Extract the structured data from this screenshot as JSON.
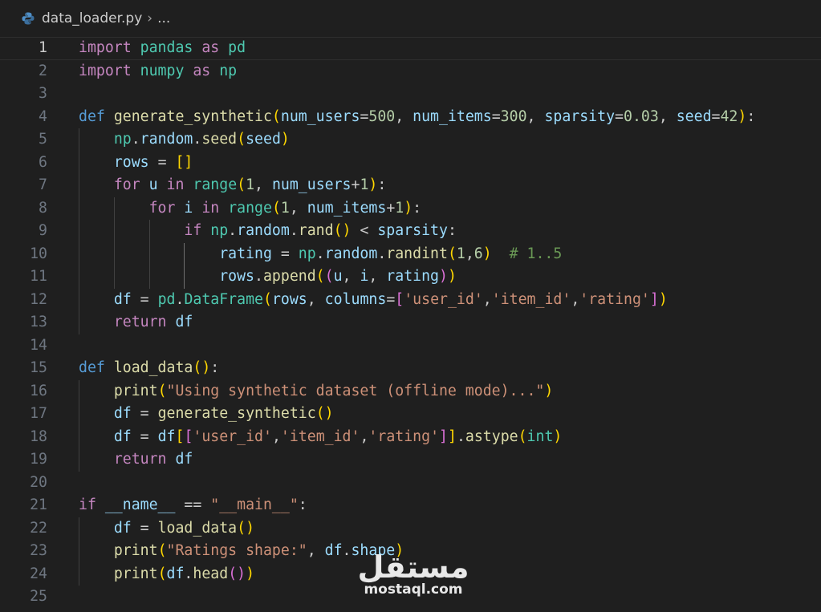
{
  "breadcrumb": {
    "file": "data_loader.py",
    "separator": "›",
    "more": "..."
  },
  "colors": {
    "keyword": "#569cd6",
    "control": "#c586c0",
    "function": "#dcdcaa",
    "variable": "#9cdcfe",
    "string": "#ce9178",
    "number": "#b5cea8",
    "type": "#4ec9b0",
    "comment": "#6a9955",
    "plain": "#cccccc",
    "bracket1": "#ffd700",
    "bracket2": "#da70d6",
    "bracket3": "#179fff"
  },
  "lines": [
    {
      "n": "1",
      "t": [
        [
          "c",
          "import"
        ],
        [
          "p",
          " "
        ],
        [
          "ty",
          "pandas"
        ],
        [
          "p",
          " "
        ],
        [
          "c",
          "as"
        ],
        [
          "p",
          " "
        ],
        [
          "ty",
          "pd"
        ]
      ]
    },
    {
      "n": "2",
      "t": [
        [
          "c",
          "import"
        ],
        [
          "p",
          " "
        ],
        [
          "ty",
          "numpy"
        ],
        [
          "p",
          " "
        ],
        [
          "c",
          "as"
        ],
        [
          "p",
          " "
        ],
        [
          "ty",
          "np"
        ]
      ]
    },
    {
      "n": "3",
      "t": []
    },
    {
      "n": "4",
      "t": [
        [
          "k",
          "def"
        ],
        [
          "p",
          " "
        ],
        [
          "f",
          "generate_synthetic"
        ],
        [
          "b1",
          "("
        ],
        [
          "v",
          "num_users"
        ],
        [
          "p",
          "="
        ],
        [
          "num",
          "500"
        ],
        [
          "p",
          ", "
        ],
        [
          "v",
          "num_items"
        ],
        [
          "p",
          "="
        ],
        [
          "num",
          "300"
        ],
        [
          "p",
          ", "
        ],
        [
          "v",
          "sparsity"
        ],
        [
          "p",
          "="
        ],
        [
          "num",
          "0.03"
        ],
        [
          "p",
          ", "
        ],
        [
          "v",
          "seed"
        ],
        [
          "p",
          "="
        ],
        [
          "num",
          "42"
        ],
        [
          "b1",
          ")"
        ],
        [
          "p",
          ":"
        ]
      ]
    },
    {
      "n": "5",
      "t": [
        [
          "p",
          "    "
        ],
        [
          "ty",
          "np"
        ],
        [
          "p",
          "."
        ],
        [
          "v",
          "random"
        ],
        [
          "p",
          "."
        ],
        [
          "f",
          "seed"
        ],
        [
          "b1",
          "("
        ],
        [
          "v",
          "seed"
        ],
        [
          "b1",
          ")"
        ]
      ]
    },
    {
      "n": "6",
      "t": [
        [
          "p",
          "    "
        ],
        [
          "v",
          "rows"
        ],
        [
          "p",
          " = "
        ],
        [
          "b1",
          "[]"
        ]
      ]
    },
    {
      "n": "7",
      "t": [
        [
          "p",
          "    "
        ],
        [
          "c",
          "for"
        ],
        [
          "p",
          " "
        ],
        [
          "v",
          "u"
        ],
        [
          "p",
          " "
        ],
        [
          "c",
          "in"
        ],
        [
          "p",
          " "
        ],
        [
          "ty",
          "range"
        ],
        [
          "b1",
          "("
        ],
        [
          "num",
          "1"
        ],
        [
          "p",
          ", "
        ],
        [
          "v",
          "num_users"
        ],
        [
          "p",
          "+"
        ],
        [
          "num",
          "1"
        ],
        [
          "b1",
          ")"
        ],
        [
          "p",
          ":"
        ]
      ]
    },
    {
      "n": "8",
      "t": [
        [
          "p",
          "        "
        ],
        [
          "c",
          "for"
        ],
        [
          "p",
          " "
        ],
        [
          "v",
          "i"
        ],
        [
          "p",
          " "
        ],
        [
          "c",
          "in"
        ],
        [
          "p",
          " "
        ],
        [
          "ty",
          "range"
        ],
        [
          "b1",
          "("
        ],
        [
          "num",
          "1"
        ],
        [
          "p",
          ", "
        ],
        [
          "v",
          "num_items"
        ],
        [
          "p",
          "+"
        ],
        [
          "num",
          "1"
        ],
        [
          "b1",
          ")"
        ],
        [
          "p",
          ":"
        ]
      ]
    },
    {
      "n": "9",
      "t": [
        [
          "p",
          "            "
        ],
        [
          "c",
          "if"
        ],
        [
          "p",
          " "
        ],
        [
          "ty",
          "np"
        ],
        [
          "p",
          "."
        ],
        [
          "v",
          "random"
        ],
        [
          "p",
          "."
        ],
        [
          "f",
          "rand"
        ],
        [
          "b1",
          "()"
        ],
        [
          "p",
          " < "
        ],
        [
          "v",
          "sparsity"
        ],
        [
          "p",
          ":"
        ]
      ]
    },
    {
      "n": "10",
      "t": [
        [
          "p",
          "                "
        ],
        [
          "v",
          "rating"
        ],
        [
          "p",
          " = "
        ],
        [
          "ty",
          "np"
        ],
        [
          "p",
          "."
        ],
        [
          "v",
          "random"
        ],
        [
          "p",
          "."
        ],
        [
          "f",
          "randint"
        ],
        [
          "b1",
          "("
        ],
        [
          "num",
          "1"
        ],
        [
          "p",
          ","
        ],
        [
          "num",
          "6"
        ],
        [
          "b1",
          ")"
        ],
        [
          "p",
          "  "
        ],
        [
          "cm",
          "# 1..5"
        ]
      ]
    },
    {
      "n": "11",
      "t": [
        [
          "p",
          "                "
        ],
        [
          "v",
          "rows"
        ],
        [
          "p",
          "."
        ],
        [
          "f",
          "append"
        ],
        [
          "b1",
          "("
        ],
        [
          "b2",
          "("
        ],
        [
          "v",
          "u"
        ],
        [
          "p",
          ", "
        ],
        [
          "v",
          "i"
        ],
        [
          "p",
          ", "
        ],
        [
          "v",
          "rating"
        ],
        [
          "b2",
          ")"
        ],
        [
          "b1",
          ")"
        ]
      ]
    },
    {
      "n": "12",
      "t": [
        [
          "p",
          "    "
        ],
        [
          "v",
          "df"
        ],
        [
          "p",
          " = "
        ],
        [
          "ty",
          "pd"
        ],
        [
          "p",
          "."
        ],
        [
          "ty",
          "DataFrame"
        ],
        [
          "b1",
          "("
        ],
        [
          "v",
          "rows"
        ],
        [
          "p",
          ", "
        ],
        [
          "v",
          "columns"
        ],
        [
          "p",
          "="
        ],
        [
          "b2",
          "["
        ],
        [
          "s",
          "'user_id'"
        ],
        [
          "p",
          ","
        ],
        [
          "s",
          "'item_id'"
        ],
        [
          "p",
          ","
        ],
        [
          "s",
          "'rating'"
        ],
        [
          "b2",
          "]"
        ],
        [
          "b1",
          ")"
        ]
      ]
    },
    {
      "n": "13",
      "t": [
        [
          "p",
          "    "
        ],
        [
          "c",
          "return"
        ],
        [
          "p",
          " "
        ],
        [
          "v",
          "df"
        ]
      ]
    },
    {
      "n": "14",
      "t": []
    },
    {
      "n": "15",
      "t": [
        [
          "k",
          "def"
        ],
        [
          "p",
          " "
        ],
        [
          "f",
          "load_data"
        ],
        [
          "b1",
          "()"
        ],
        [
          "p",
          ":"
        ]
      ]
    },
    {
      "n": "16",
      "t": [
        [
          "p",
          "    "
        ],
        [
          "f",
          "print"
        ],
        [
          "b1",
          "("
        ],
        [
          "s",
          "\"Using synthetic dataset (offline mode)...\""
        ],
        [
          "b1",
          ")"
        ]
      ]
    },
    {
      "n": "17",
      "t": [
        [
          "p",
          "    "
        ],
        [
          "v",
          "df"
        ],
        [
          "p",
          " = "
        ],
        [
          "f",
          "generate_synthetic"
        ],
        [
          "b1",
          "()"
        ]
      ]
    },
    {
      "n": "18",
      "t": [
        [
          "p",
          "    "
        ],
        [
          "v",
          "df"
        ],
        [
          "p",
          " = "
        ],
        [
          "v",
          "df"
        ],
        [
          "b1",
          "["
        ],
        [
          "b2",
          "["
        ],
        [
          "s",
          "'user_id'"
        ],
        [
          "p",
          ","
        ],
        [
          "s",
          "'item_id'"
        ],
        [
          "p",
          ","
        ],
        [
          "s",
          "'rating'"
        ],
        [
          "b2",
          "]"
        ],
        [
          "b1",
          "]"
        ],
        [
          "p",
          "."
        ],
        [
          "f",
          "astype"
        ],
        [
          "b1",
          "("
        ],
        [
          "ty",
          "int"
        ],
        [
          "b1",
          ")"
        ]
      ]
    },
    {
      "n": "19",
      "t": [
        [
          "p",
          "    "
        ],
        [
          "c",
          "return"
        ],
        [
          "p",
          " "
        ],
        [
          "v",
          "df"
        ]
      ]
    },
    {
      "n": "20",
      "t": []
    },
    {
      "n": "21",
      "t": [
        [
          "c",
          "if"
        ],
        [
          "p",
          " "
        ],
        [
          "v",
          "__name__"
        ],
        [
          "p",
          " == "
        ],
        [
          "s",
          "\"__main__\""
        ],
        [
          "p",
          ":"
        ]
      ]
    },
    {
      "n": "22",
      "t": [
        [
          "p",
          "    "
        ],
        [
          "v",
          "df"
        ],
        [
          "p",
          " = "
        ],
        [
          "f",
          "load_data"
        ],
        [
          "b1",
          "()"
        ]
      ]
    },
    {
      "n": "23",
      "t": [
        [
          "p",
          "    "
        ],
        [
          "f",
          "print"
        ],
        [
          "b1",
          "("
        ],
        [
          "s",
          "\"Ratings shape:\""
        ],
        [
          "p",
          ", "
        ],
        [
          "v",
          "df"
        ],
        [
          "p",
          "."
        ],
        [
          "v",
          "shape"
        ],
        [
          "b1",
          ")"
        ]
      ]
    },
    {
      "n": "24",
      "t": [
        [
          "p",
          "    "
        ],
        [
          "f",
          "print"
        ],
        [
          "b1",
          "("
        ],
        [
          "v",
          "df"
        ],
        [
          "p",
          "."
        ],
        [
          "f",
          "head"
        ],
        [
          "b2",
          "()"
        ],
        [
          "b1",
          ")"
        ]
      ]
    },
    {
      "n": "25",
      "t": []
    }
  ],
  "watermark": {
    "arabic": "مستقل",
    "latin": "mostaql.com"
  }
}
